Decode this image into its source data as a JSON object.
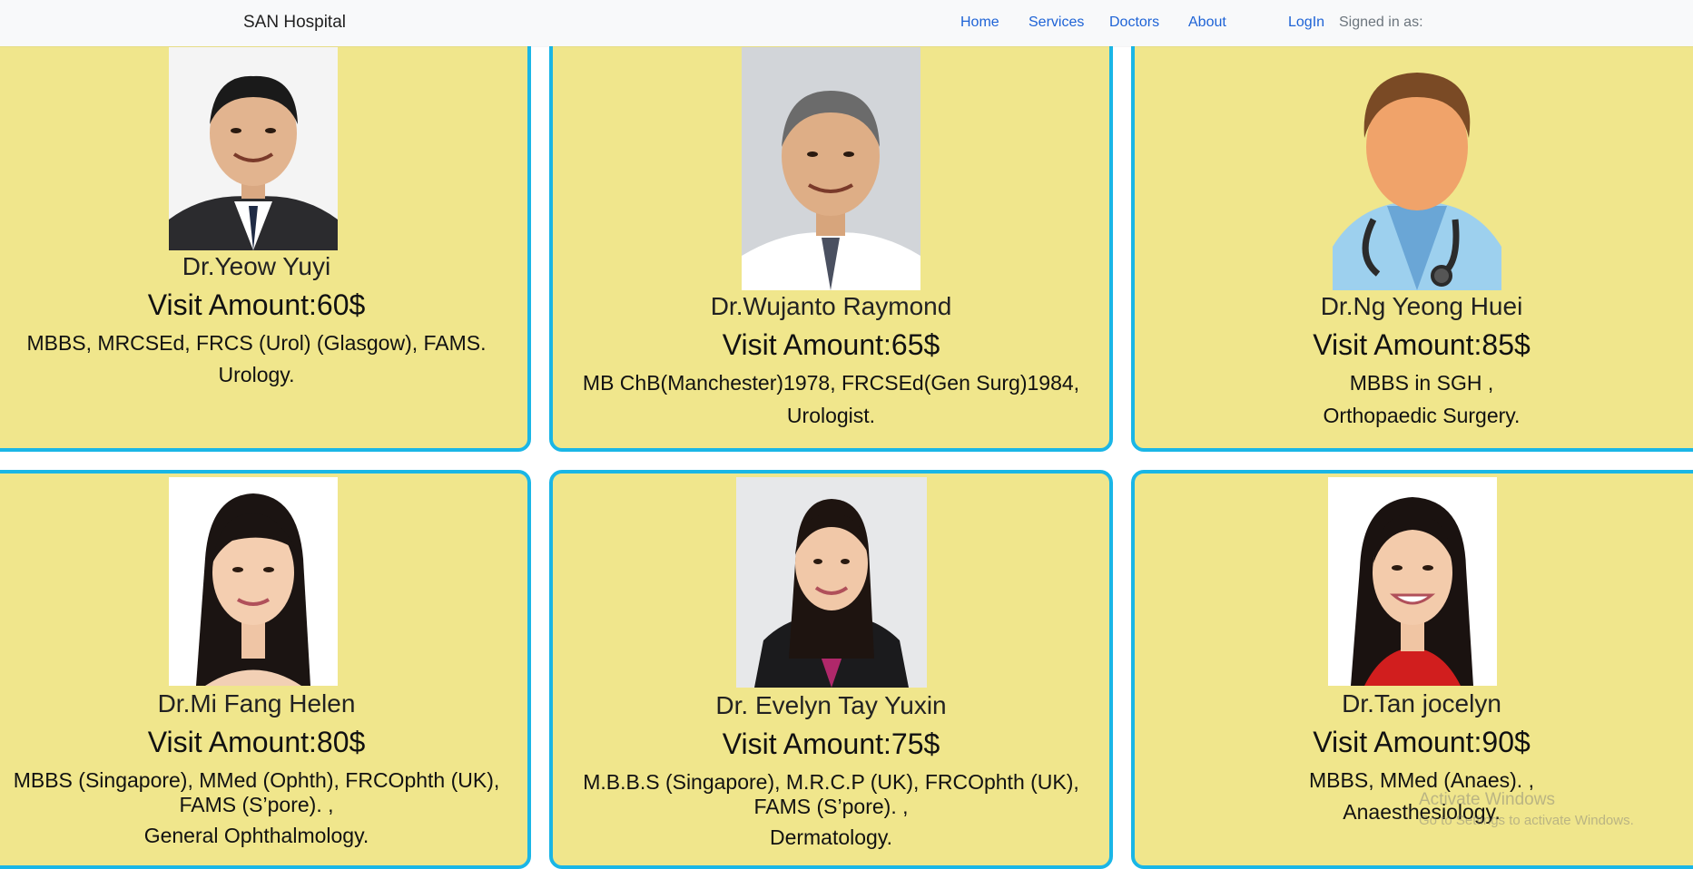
{
  "navbar": {
    "brand": "SAN Hospital",
    "links": [
      "Home",
      "Services",
      "Doctors",
      "About"
    ],
    "login": "LogIn",
    "signed_in": "Signed in as:"
  },
  "doctors": [
    {
      "name": "Dr.Yeow Yuyi",
      "visit": "Visit Amount:60$",
      "qualifications": "MBBS, MRCSEd, FRCS (Urol) (Glasgow), FAMS.",
      "specialty": "Urology.",
      "photo": "male-doctor-suit-photo"
    },
    {
      "name": "Dr.Wujanto Raymond",
      "visit": "Visit Amount:65$",
      "qualifications": "MB ChB(Manchester)1978, FRCSEd(Gen Surg)1984,",
      "specialty": "Urologist.",
      "photo": "senior-male-doctor-photo"
    },
    {
      "name": "Dr.Ng Yeong Huei",
      "visit": "Visit Amount:85$",
      "qualifications": "MBBS in SGH ,",
      "specialty": "Orthopaedic Surgery.",
      "photo": "doctor-avatar-icon"
    },
    {
      "name": "Dr.Mi Fang Helen",
      "visit": "Visit Amount:80$",
      "qualifications": "MBBS (Singapore), MMed (Ophth), FRCOphth (UK),",
      "qualifications2": "FAMS (S’pore). ,",
      "specialty": "General Ophthalmology.",
      "photo": "female-doctor-photo"
    },
    {
      "name": "Dr. Evelyn Tay Yuxin",
      "visit": "Visit Amount:75$",
      "qualifications": "M.B.B.S (Singapore), M.R.C.P (UK), FRCOphth (UK),",
      "qualifications2": "FAMS (S’pore). ,",
      "specialty": "Dermatology.",
      "photo": "female-doctor-blazer-photo"
    },
    {
      "name": "Dr.Tan jocelyn",
      "visit": "Visit Amount:90$",
      "qualifications": "MBBS, MMed (Anaes). ,",
      "specialty": "Anaesthesiology.",
      "photo": "female-doctor-red-top-photo"
    }
  ],
  "watermark": {
    "title": "Activate Windows",
    "subtitle": "Go to Settings to activate Windows."
  },
  "colors": {
    "card_bg": "#f0e68c",
    "card_border": "#1ab6e6",
    "nav_link": "#1e63d6",
    "navbar_bg": "#f8f9fa"
  }
}
